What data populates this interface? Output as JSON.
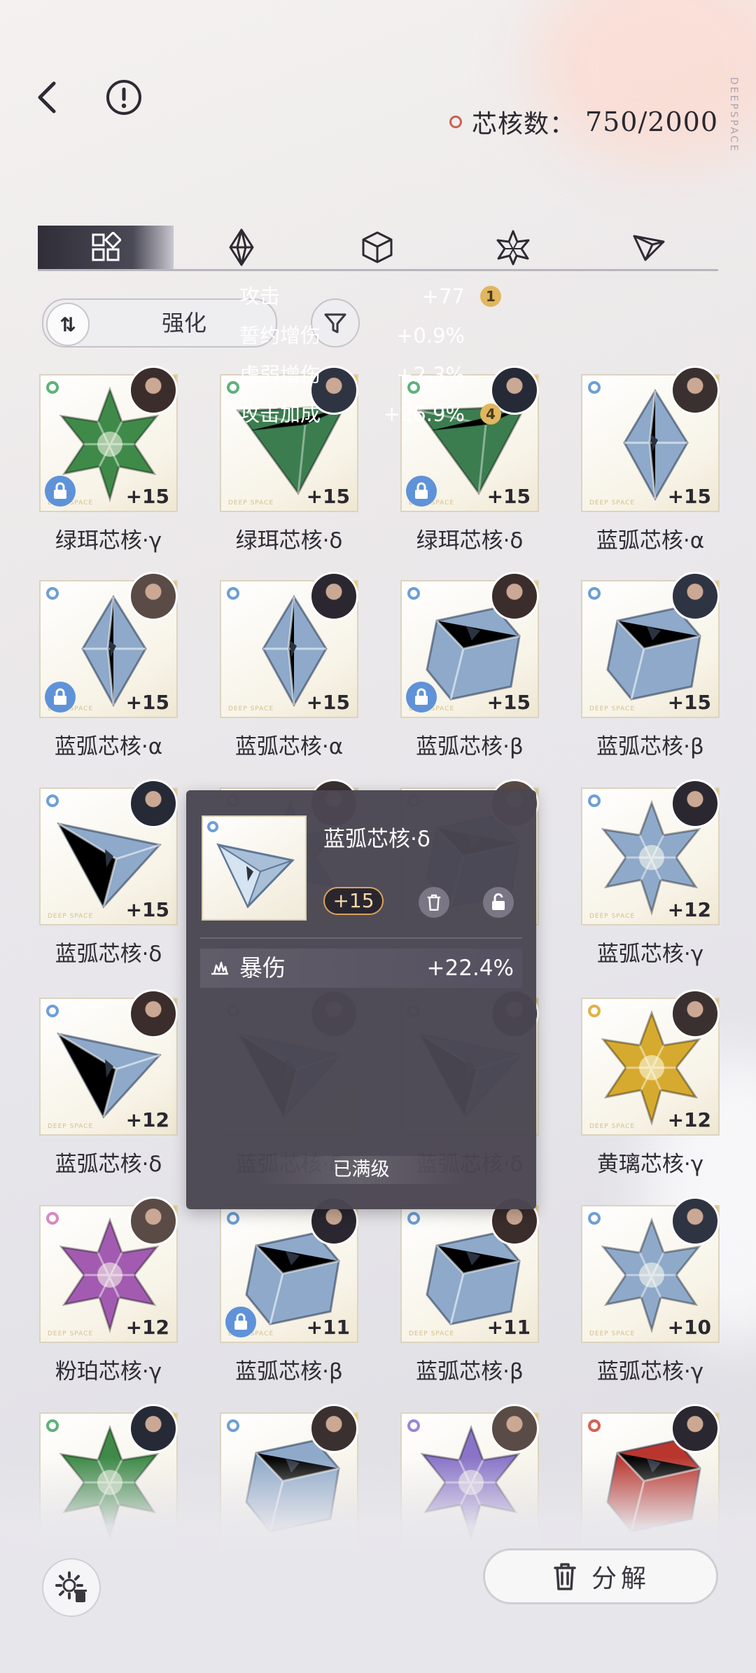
{
  "header": {
    "counter_label": "芯核数：",
    "counter_value": "750/2000",
    "brand_vertical": "DEEPSPACE"
  },
  "tabs": [
    {
      "icon": "grid-all-icon",
      "active": true
    },
    {
      "icon": "diamond-icon",
      "active": false
    },
    {
      "icon": "cube-icon",
      "active": false
    },
    {
      "icon": "star-cluster-icon",
      "active": false
    },
    {
      "icon": "triangle-icon",
      "active": false
    }
  ],
  "sort": {
    "label": "强化",
    "icon": "sort-order-icon"
  },
  "items": [
    {
      "name": "绿珥芯核·γ",
      "level": "+15",
      "rarity_color": "#5fb17a",
      "locked": true,
      "gem": "star",
      "gem_color": "#3f8a48"
    },
    {
      "name": "绿珥芯核·δ",
      "level": "+15",
      "rarity_color": "#5fb17a",
      "locked": false,
      "gem": "prism",
      "gem_color": "#3c7d4f"
    },
    {
      "name": "绿珥芯核·δ",
      "level": "+15",
      "rarity_color": "#5fb17a",
      "locked": true,
      "gem": "prism",
      "gem_color": "#3c7d4f"
    },
    {
      "name": "蓝弧芯核·α",
      "level": "+15",
      "rarity_color": "#6d9fd6",
      "locked": false,
      "gem": "octa",
      "gem_color": "#8ea9c9"
    },
    {
      "name": "蓝弧芯核·α",
      "level": "+15",
      "rarity_color": "#6d9fd6",
      "locked": true,
      "gem": "octa",
      "gem_color": "#8ea9c9"
    },
    {
      "name": "蓝弧芯核·α",
      "level": "+15",
      "rarity_color": "#6d9fd6",
      "locked": false,
      "gem": "octa",
      "gem_color": "#8ea9c9"
    },
    {
      "name": "蓝弧芯核·β",
      "level": "+15",
      "rarity_color": "#6d9fd6",
      "locked": true,
      "gem": "cube",
      "gem_color": "#8ea9c9"
    },
    {
      "name": "蓝弧芯核·β",
      "level": "+15",
      "rarity_color": "#6d9fd6",
      "locked": false,
      "gem": "cube",
      "gem_color": "#8ea9c9"
    },
    {
      "name": "蓝弧芯核·δ",
      "level": "+15",
      "rarity_color": "#6d9fd6",
      "locked": false,
      "gem": "tetra",
      "gem_color": "#8ea9c9"
    },
    {
      "name": "",
      "level": "",
      "rarity_color": "#6d9fd6",
      "locked": false,
      "gem": "star",
      "gem_color": "#8ea9c9"
    },
    {
      "name": "",
      "level": "",
      "rarity_color": "#6d9fd6",
      "locked": false,
      "gem": "cube",
      "gem_color": "#8ea9c9"
    },
    {
      "name": "蓝弧芯核·γ",
      "level": "+12",
      "rarity_color": "#6d9fd6",
      "locked": false,
      "gem": "star",
      "gem_color": "#8ea9c9"
    },
    {
      "name": "蓝弧芯核·δ",
      "level": "+12",
      "rarity_color": "#6d9fd6",
      "locked": false,
      "gem": "tetra",
      "gem_color": "#8ea9c9"
    },
    {
      "name": "蓝弧芯核·δ",
      "level": "",
      "rarity_color": "#6d9fd6",
      "locked": false,
      "gem": "tetra",
      "gem_color": "#8ea9c9"
    },
    {
      "name": "蓝弧芯核·δ",
      "level": "",
      "rarity_color": "#6d9fd6",
      "locked": false,
      "gem": "tetra",
      "gem_color": "#8ea9c9"
    },
    {
      "name": "黄璃芯核·γ",
      "level": "+12",
      "rarity_color": "#e0b246",
      "locked": false,
      "gem": "star",
      "gem_color": "#d6aa2e"
    },
    {
      "name": "粉珀芯核·γ",
      "level": "+12",
      "rarity_color": "#d789c0",
      "locked": false,
      "gem": "star",
      "gem_color": "#a25bb0"
    },
    {
      "name": "蓝弧芯核·β",
      "level": "+11",
      "rarity_color": "#6d9fd6",
      "locked": true,
      "gem": "cube",
      "gem_color": "#8ea9c9"
    },
    {
      "name": "蓝弧芯核·β",
      "level": "+11",
      "rarity_color": "#6d9fd6",
      "locked": false,
      "gem": "cube",
      "gem_color": "#8ea9c9"
    },
    {
      "name": "蓝弧芯核·γ",
      "level": "+10",
      "rarity_color": "#6d9fd6",
      "locked": false,
      "gem": "star",
      "gem_color": "#8ea9c9"
    },
    {
      "name": "",
      "level": "",
      "rarity_color": "#5fb17a",
      "locked": false,
      "gem": "star",
      "gem_color": "#3f8a48"
    },
    {
      "name": "",
      "level": "",
      "rarity_color": "#6d9fd6",
      "locked": false,
      "gem": "cube",
      "gem_color": "#8ea9c9"
    },
    {
      "name": "",
      "level": "",
      "rarity_color": "#9a86d6",
      "locked": false,
      "gem": "star",
      "gem_color": "#8a74c8"
    },
    {
      "name": "",
      "level": "",
      "rarity_color": "#d8604f",
      "locked": false,
      "gem": "cube",
      "gem_color": "#b8362e"
    }
  ],
  "popup": {
    "title": "蓝弧芯核·δ",
    "level": "+15",
    "main_stat": {
      "label": "暴伤",
      "value": "+22.4%"
    },
    "sub_stats": [
      {
        "label": "攻击",
        "value": "+77",
        "badge": "1"
      },
      {
        "label": "誓约增伤",
        "value": "+0.9%",
        "badge": ""
      },
      {
        "label": "虚弱增伤",
        "value": "+2.3%",
        "badge": ""
      },
      {
        "label": "攻击加成",
        "value": "+26.9%",
        "badge": "4"
      }
    ],
    "maxed": "已满级"
  },
  "footer": {
    "decompose_label": "分解"
  }
}
